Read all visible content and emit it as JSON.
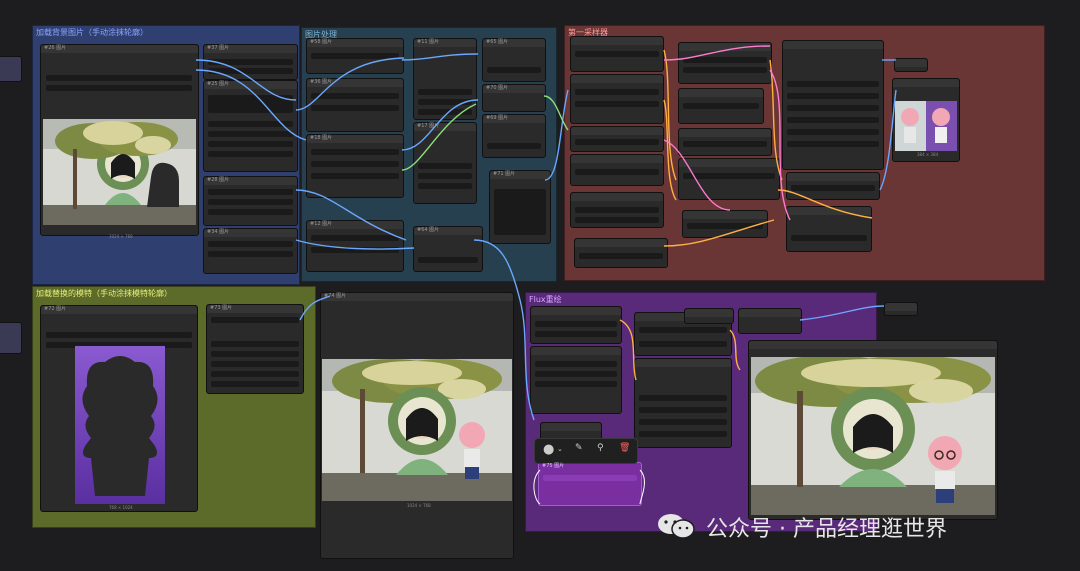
{
  "groups": {
    "load_image": {
      "title": "加载背景图片（手动涂抹轮廓）",
      "color": "#2f3f70",
      "title_color": "#8ea6ff"
    },
    "preprocess": {
      "title": "图片处理",
      "color": "#27404f",
      "title_color": "#7fb3d5"
    },
    "sampler": {
      "title": "第一采样器",
      "color": "#6a3535",
      "title_color": "#ff9a9a"
    },
    "load_model": {
      "title": "加载替换的模特（手动涂抹模特轮廓）",
      "color": "#5c6a2a",
      "title_color": "#e8f07a"
    },
    "flux_fill": {
      "title": "Flux重绘",
      "color": "#5a2a7a",
      "title_color": "#d9a8ff"
    }
  },
  "nodes": {
    "n1": "#26 图片",
    "n2": "#37 图片",
    "n3": "#25 图片",
    "n4": "#28 图片",
    "n5": "#34 图片",
    "n6": "#58 图片",
    "n7": "#36 图片",
    "n8": "#18 图片",
    "n9": "#12 图片",
    "n10": "#11 图片",
    "n11": "#17 图片",
    "n12": "#64 图片",
    "n13": "#65 图片",
    "n14": "#70 图片",
    "n15": "#69 图片",
    "n16": "#71 图片",
    "n17": "#72 图片",
    "n18": "#73 图片",
    "n19": "#74 图片",
    "n20": "#75 图片"
  },
  "captions": {
    "bg_image": "1024 × 768",
    "model_image": "768 × 1024",
    "preview_small": "384 × 384",
    "preview_mid": "1024 × 768",
    "preview_final": "1024 × 768"
  },
  "toolbar": {
    "color_icon": "color-circle-icon",
    "pin_icon": "pin-icon",
    "pen_icon": "pen-icon",
    "delete_icon": "trash-icon"
  },
  "watermark": {
    "text": "公众号 · 产品经理逛世界",
    "icon": "wechat-icon"
  },
  "colors": {
    "canvas": "#1d1d1f",
    "node": "#2a2a2a",
    "wire_blue": "#6aa8ff",
    "wire_orange": "#ffb040",
    "wire_pink": "#ff7ad0",
    "wire_green": "#8ae07a"
  }
}
